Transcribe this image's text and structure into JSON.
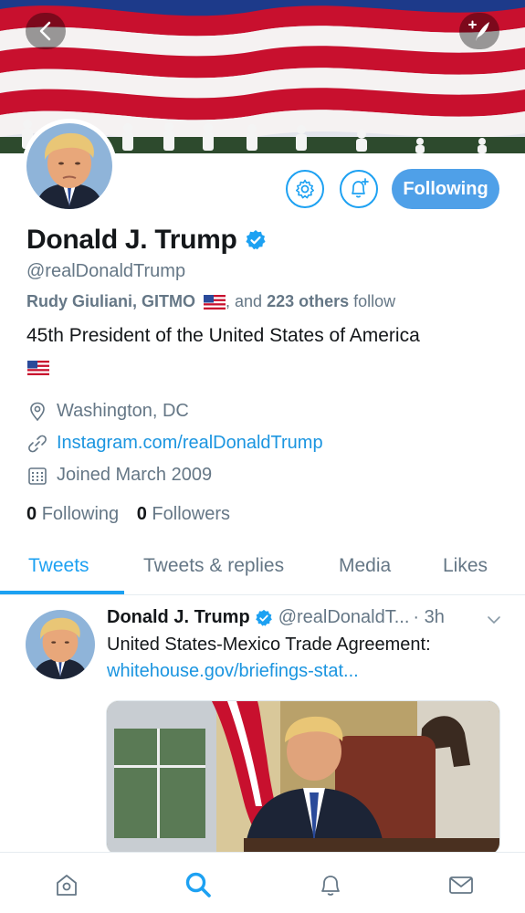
{
  "header": {
    "back_icon": "chevron-left-icon",
    "compose_icon": "compose-tweet-icon"
  },
  "profile": {
    "name": "Donald J. Trump",
    "handle": "@realDonaldTrump",
    "followed_by_prefix": "Rudy Giuliani, GITMO",
    "followed_by_middle": ", and ",
    "followed_by_count": "223 others",
    "followed_by_suffix": " follow",
    "bio": "45th President of the United States of America",
    "location": "Washington, DC",
    "website": "Instagram.com/realDonaldTrump",
    "joined": "Joined March 2009",
    "following_count": "0",
    "following_label": "Following",
    "followers_count": "0",
    "followers_label": "Followers",
    "follow_button_label": "Following"
  },
  "tabs": [
    {
      "label": "Tweets",
      "active": true
    },
    {
      "label": "Tweets & replies",
      "active": false
    },
    {
      "label": "Media",
      "active": false
    },
    {
      "label": "Likes",
      "active": false
    }
  ],
  "tweet": {
    "author": "Donald J. Trump",
    "handle": "@realDonaldT...",
    "time": "· 3h",
    "text": "United States-Mexico Trade Agreement:",
    "link": "whitehouse.gov/briefings-stat..."
  },
  "bottom_nav": [
    "home-icon",
    "search-icon",
    "notifications-icon",
    "messages-icon"
  ],
  "colors": {
    "accent": "#1da1f2",
    "link": "#1b95e0",
    "secondary_text": "#657786"
  }
}
